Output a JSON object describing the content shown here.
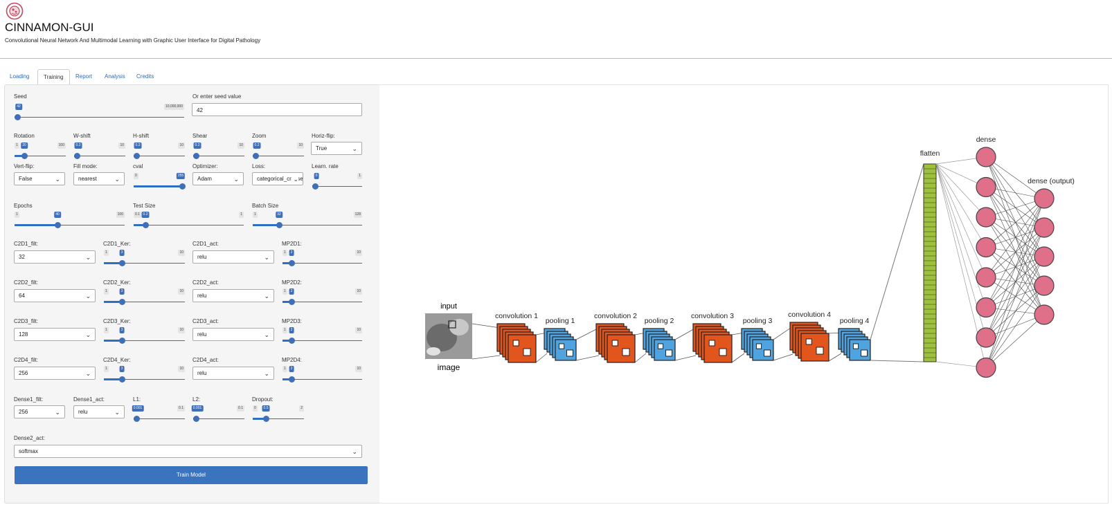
{
  "app": {
    "logo_icon": "cinnamon-logo-icon",
    "title": "CINNAMON-GUI",
    "subtitle": "Convolutional Neural Network And Multimodal Learning with Graphic User Interface for Digital Pathology"
  },
  "tabs": [
    "Loading",
    "Training",
    "Report",
    "Analysis",
    "Credits"
  ],
  "active_tab": "Training",
  "seed": {
    "label": "Seed",
    "min": "",
    "max": "10,000,000",
    "value": "42",
    "fraction": 0.0
  },
  "seed_input": {
    "label": "Or enter seed value",
    "value": "42"
  },
  "aug": {
    "rotation": {
      "label": "Rotation",
      "min": "1",
      "max": "100",
      "value": "20",
      "fraction": 0.19
    },
    "wshift": {
      "label": "W-shift",
      "min": "",
      "max": "10",
      "value": "0.2",
      "fraction": 0.0
    },
    "hshift": {
      "label": "H-shift",
      "min": "",
      "max": "10",
      "value": "0.2",
      "fraction": 0.0
    },
    "shear": {
      "label": "Shear",
      "min": "",
      "max": "10",
      "value": "0.2",
      "fraction": 0.0
    },
    "zoom": {
      "label": "Zoom",
      "min": "",
      "max": "10",
      "value": "0.2",
      "fraction": 0.0
    },
    "horiz_flip": {
      "label": "Horiz-flip:",
      "value": "True"
    }
  },
  "row2": {
    "vert_flip": {
      "label": "Vert-flip:",
      "value": "False"
    },
    "fill_mode": {
      "label": "Fill mode:",
      "value": "nearest"
    },
    "cval": {
      "label": "cval",
      "min": "0",
      "max": "255",
      "value": "255",
      "fraction": 1.0
    },
    "optimizer": {
      "label": "Optimizer:",
      "value": "Adam"
    },
    "loss": {
      "label": "Loss:",
      "value": "categorical_crossentropy"
    },
    "lr": {
      "label": "Learn. rate",
      "min": "",
      "max": "1",
      "value": "0",
      "fraction": 0.0
    }
  },
  "train": {
    "epochs": {
      "label": "Epochs",
      "min": "1",
      "max": "100",
      "value": "40",
      "fraction": 0.39
    },
    "test_size": {
      "label": "Test Size",
      "min": "0.1",
      "max": "1",
      "value": "0.2",
      "fraction": 0.11
    },
    "batch_size": {
      "label": "Batch Size",
      "min": "1",
      "max": "128",
      "value": "32",
      "fraction": 0.24
    }
  },
  "conv_rows": [
    {
      "filt_label": "C2D1_filt:",
      "filt": "32",
      "ker_label": "C2D1_Ker:",
      "ker": "3",
      "act_label": "C2D1_act:",
      "act": "relu",
      "mp_label": "MP2D1:",
      "mp": "2"
    },
    {
      "filt_label": "C2D2_filt:",
      "filt": "64",
      "ker_label": "C2D2_Ker:",
      "ker": "3",
      "act_label": "C2D2_act:",
      "act": "relu",
      "mp_label": "MP2D2:",
      "mp": "2"
    },
    {
      "filt_label": "C2D3_filt:",
      "filt": "128",
      "ker_label": "C2D3_Ker:",
      "ker": "3",
      "act_label": "C2D3_act:",
      "act": "relu",
      "mp_label": "MP2D3:",
      "mp": "2"
    },
    {
      "filt_label": "C2D4_filt:",
      "filt": "256",
      "ker_label": "C2D4_Ker:",
      "ker": "3",
      "act_label": "C2D4_act:",
      "act": "relu",
      "mp_label": "MP2D4:",
      "mp": "2"
    }
  ],
  "conv_ker_range": {
    "min": "1",
    "max": "10",
    "fraction": 0.22
  },
  "conv_mp_range": {
    "min": "1",
    "max": "10",
    "fraction": 0.11
  },
  "dense": {
    "filt": {
      "label": "Dense1_filt:",
      "value": "256"
    },
    "act": {
      "label": "Dense1_act:",
      "value": "relu"
    },
    "l1": {
      "label": "L1:",
      "min": "",
      "max": "0.1",
      "value": "0.001",
      "fraction": 0.0
    },
    "l2": {
      "label": "L2:",
      "min": "",
      "max": "0.1",
      "value": "0.001",
      "fraction": 0.0
    },
    "dropout": {
      "label": "Dropout:",
      "min": "0",
      "max": "2",
      "value": "0.5",
      "fraction": 0.25
    }
  },
  "dense2": {
    "label": "Dense2_act:",
    "value": "softmax"
  },
  "train_button": "Train Model",
  "diagram": {
    "input_label": "input",
    "image_label": "image",
    "stages": [
      {
        "label": "convolution 1",
        "color": "#e2561e"
      },
      {
        "label": "pooling 1",
        "color": "#4fa3df"
      },
      {
        "label": "convolution 2",
        "color": "#e2561e"
      },
      {
        "label": "pooling 2",
        "color": "#4fa3df"
      },
      {
        "label": "convolution 3",
        "color": "#e2561e"
      },
      {
        "label": "pooling 3",
        "color": "#4fa3df"
      },
      {
        "label": "convolution 4",
        "color": "#e2561e"
      },
      {
        "label": "pooling 4",
        "color": "#4fa3df"
      }
    ],
    "flatten_label": "flatten",
    "flatten_color": "#9dc13a",
    "dense_label": "dense",
    "output_label": "dense (output)",
    "node_color": "#e0708a",
    "dense_nodes": 8,
    "output_nodes": 5
  }
}
